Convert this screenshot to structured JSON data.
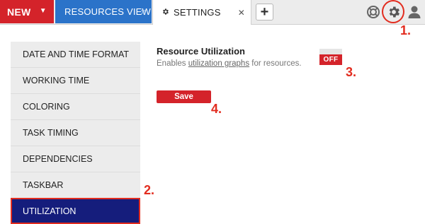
{
  "topbar": {
    "new_label": "NEW",
    "new_caret": "▼",
    "tabs": [
      {
        "label": "Resources View",
        "close": "✕"
      },
      {
        "label": "Settings",
        "close": "✕"
      }
    ],
    "add_tab": "+"
  },
  "sidebar": {
    "items": [
      {
        "label": "Date and Time Format"
      },
      {
        "label": "Working Time"
      },
      {
        "label": "Coloring"
      },
      {
        "label": "Task Timing"
      },
      {
        "label": "Dependencies"
      },
      {
        "label": "Taskbar"
      },
      {
        "label": "Utilization"
      }
    ],
    "active_item": "Utilization"
  },
  "setting": {
    "title": "Resource Utilization",
    "desc_before": "Enables ",
    "desc_link": "utilization graphs",
    "desc_after": " for resources.",
    "toggle_state": "OFF"
  },
  "save_label": "Save",
  "callouts": [
    "1.",
    "2.",
    "3.",
    "4."
  ],
  "colors": {
    "accent_red": "#d4232a",
    "tab_blue": "#2b73c9",
    "active_navy": "#151d7c",
    "callout_red": "#e22c1f"
  }
}
